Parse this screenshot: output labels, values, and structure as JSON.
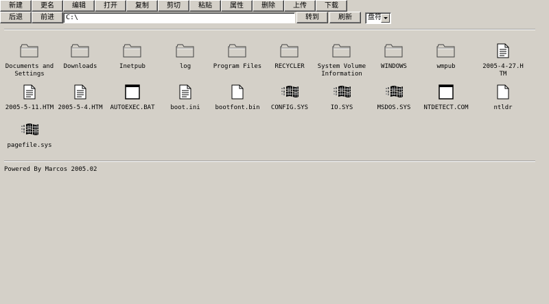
{
  "toolbar": {
    "row1": [
      {
        "label": "新建",
        "name": "new-button"
      },
      {
        "label": "更名",
        "name": "rename-button"
      },
      {
        "label": "编辑",
        "name": "edit-button"
      },
      {
        "label": "打开",
        "name": "open-button"
      },
      {
        "label": "复制",
        "name": "copy-button"
      },
      {
        "label": "剪切",
        "name": "cut-button"
      },
      {
        "label": "粘贴",
        "name": "paste-button"
      },
      {
        "label": "属性",
        "name": "properties-button"
      },
      {
        "label": "删除",
        "name": "delete-button"
      },
      {
        "label": "上传",
        "name": "upload-button"
      },
      {
        "label": "下载",
        "name": "download-button"
      }
    ],
    "back_label": "后退",
    "forward_label": "前进",
    "goto_label": "转到",
    "refresh_label": "刷新",
    "drive_label": "盘符"
  },
  "path": {
    "value": "C:\\"
  },
  "files": [
    {
      "label": "Documents and Settings",
      "icon": "folder-icon"
    },
    {
      "label": "Downloads",
      "icon": "folder-icon"
    },
    {
      "label": "Inetpub",
      "icon": "folder-icon"
    },
    {
      "label": "log",
      "icon": "folder-icon"
    },
    {
      "label": "Program Files",
      "icon": "folder-icon"
    },
    {
      "label": "RECYCLER",
      "icon": "folder-icon"
    },
    {
      "label": "System Volume Information",
      "icon": "folder-icon"
    },
    {
      "label": "WINDOWS",
      "icon": "folder-icon"
    },
    {
      "label": "wmpub",
      "icon": "folder-icon"
    },
    {
      "label": "2005-4-27.HTM",
      "icon": "text-document-icon"
    },
    {
      "label": "2005-5-11.HTM",
      "icon": "text-document-icon"
    },
    {
      "label": "2005-5-4.HTM",
      "icon": "text-document-icon"
    },
    {
      "label": "AUTOEXEC.BAT",
      "icon": "batch-window-icon"
    },
    {
      "label": "boot.ini",
      "icon": "text-document-icon"
    },
    {
      "label": "bootfont.bin",
      "icon": "blank-document-icon"
    },
    {
      "label": "CONFIG.SYS",
      "icon": "windows-system-icon"
    },
    {
      "label": "IO.SYS",
      "icon": "windows-system-icon"
    },
    {
      "label": "MSDOS.SYS",
      "icon": "windows-system-icon"
    },
    {
      "label": "NTDETECT.COM",
      "icon": "batch-window-icon"
    },
    {
      "label": "ntldr",
      "icon": "blank-document-icon"
    },
    {
      "label": "pagefile.sys",
      "icon": "windows-system-icon"
    }
  ],
  "footer": {
    "text": "Powered By Marcos 2005.02"
  }
}
